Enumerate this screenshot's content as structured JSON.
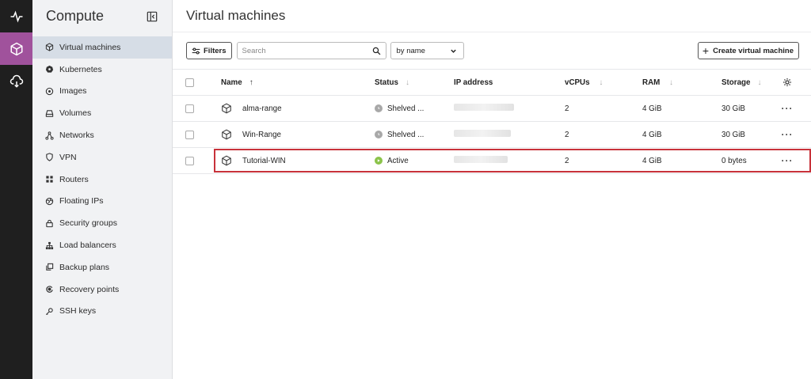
{
  "rail": {
    "items": [
      {
        "icon": "activity-icon",
        "active": false
      },
      {
        "icon": "cube-icon",
        "active": true
      },
      {
        "icon": "cloud-icon",
        "active": false
      }
    ]
  },
  "sidebar": {
    "title": "Compute",
    "items": [
      {
        "label": "Virtual machines",
        "icon": "cube-icon",
        "active": true
      },
      {
        "label": "Kubernetes",
        "icon": "kubernetes-icon"
      },
      {
        "label": "Images",
        "icon": "disc-icon"
      },
      {
        "label": "Volumes",
        "icon": "drive-icon"
      },
      {
        "label": "Networks",
        "icon": "network-icon"
      },
      {
        "label": "VPN",
        "icon": "shield-icon"
      },
      {
        "label": "Routers",
        "icon": "router-icon"
      },
      {
        "label": "Floating IPs",
        "icon": "globe-icon"
      },
      {
        "label": "Security groups",
        "icon": "lock-icon"
      },
      {
        "label": "Load balancers",
        "icon": "hierarchy-icon"
      },
      {
        "label": "Backup plans",
        "icon": "backup-icon"
      },
      {
        "label": "Recovery points",
        "icon": "recovery-icon"
      },
      {
        "label": "SSH keys",
        "icon": "key-icon"
      }
    ]
  },
  "main": {
    "title": "Virtual machines",
    "toolbar": {
      "filters_label": "Filters",
      "search_placeholder": "Search",
      "sort_value": "by name",
      "create_label": "Create virtual machine"
    },
    "table": {
      "columns": {
        "name": "Name",
        "status": "Status",
        "ip": "IP address",
        "vcpus": "vCPUs",
        "ram": "RAM",
        "storage": "Storage"
      },
      "rows": [
        {
          "name": "alma-range",
          "status": "Shelved ...",
          "status_type": "shelved",
          "vcpus": "2",
          "ram": "4 GiB",
          "storage": "30 GiB",
          "highlight": false
        },
        {
          "name": "Win-Range",
          "status": "Shelved ...",
          "status_type": "shelved",
          "vcpus": "2",
          "ram": "4 GiB",
          "storage": "30 GiB",
          "highlight": false
        },
        {
          "name": "Tutorial-WIN",
          "status": "Active",
          "status_type": "active",
          "vcpus": "2",
          "ram": "4 GiB",
          "storage": "0 bytes",
          "highlight": true
        }
      ]
    }
  },
  "colors": {
    "rail_bg": "#1f1f1f",
    "rail_active": "#a0529c",
    "sidebar_bg": "#f1f2f4",
    "sidebar_active": "#d6dde6",
    "highlight_border": "#c8323a",
    "status_active": "#8bc34a",
    "status_shelved": "#a8a8a8"
  }
}
